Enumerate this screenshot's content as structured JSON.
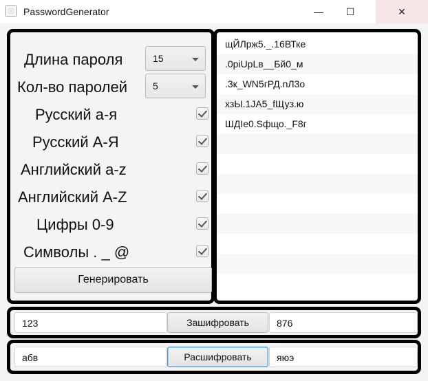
{
  "window": {
    "title": "PasswordGenerator",
    "minimize_glyph": "—",
    "maximize_glyph": "☐",
    "close_glyph": "✕"
  },
  "settings": {
    "length_label": "Длина пароля",
    "length_value": "15",
    "count_label": "Кол-во паролей",
    "count_value": "5",
    "options": [
      {
        "label": "Русский а-я",
        "checked": true
      },
      {
        "label": "Русский А-Я",
        "checked": true
      },
      {
        "label": "Английский a-z",
        "checked": true
      },
      {
        "label": "Английский A-Z",
        "checked": true
      },
      {
        "label": "Цифры 0-9",
        "checked": true
      },
      {
        "label": "Символы . _ @",
        "checked": true
      }
    ],
    "generate_label": "Генерировать"
  },
  "passwords": [
    "щЙЛрж5._.16ВТке",
    ".0рiUpLв__Бй0_м",
    ".3к_WN5гРД.nЛ3о",
    "хзЫ.1JA5_fЩуз.ю",
    "ШДIe0.Sфщо._F8г"
  ],
  "encrypt": {
    "input": "123",
    "button_label": "Зашифровать",
    "output": "876"
  },
  "decrypt": {
    "input": "абв",
    "button_label": "Расшифровать",
    "output": "яюэ"
  }
}
